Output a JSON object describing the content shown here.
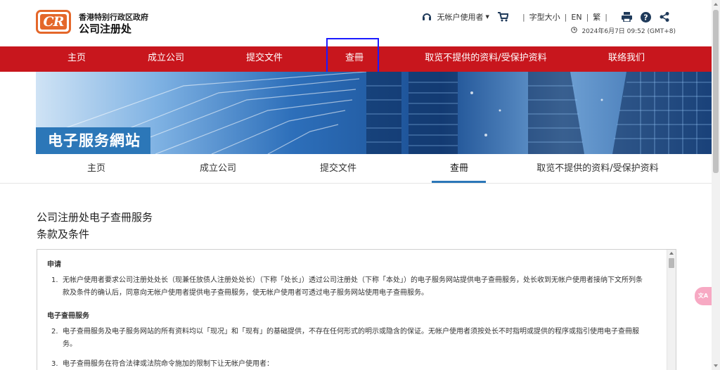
{
  "header": {
    "logo_badge": "CR",
    "org_line1": "香港特别行政区政府",
    "org_line2": "公司注册处",
    "user_label": "无帐户使用者",
    "font_size_label": "字型大小",
    "lang_en": "EN",
    "lang_tc": "繁",
    "datetime": "2024年6月7日 09:52 (GMT+8)"
  },
  "main_nav": {
    "items": [
      {
        "label": "主页"
      },
      {
        "label": "成立公司"
      },
      {
        "label": "提交文件"
      },
      {
        "label": "查冊"
      },
      {
        "label": "取览不提供的资料/受保护资料"
      },
      {
        "label": "联络我们"
      }
    ],
    "focused_index": 3
  },
  "banner": {
    "title": "电子服务網站"
  },
  "sub_nav": {
    "items": [
      {
        "label": "主页"
      },
      {
        "label": "成立公司"
      },
      {
        "label": "提交文件"
      },
      {
        "label": "查冊"
      },
      {
        "label": "取览不提供的资料/受保护资料"
      }
    ],
    "active_index": 3
  },
  "content": {
    "title": "公司注册处电子查冊服务",
    "subtitle": "条款及条件",
    "section1_heading": "申请",
    "clause1_num": "1.",
    "clause1_text": "无帐户使用者要求公司注册处处长（现兼任放债人注册处处长）（下称「处长」）透过公司注册处（下称「本处」）的电子服务网站提供电子查冊服务，处长收到无帐户使用者接纳下文所列条款及条件的确认后，同意向无帐户使用者提供电子查冊服务，使无帐户使用者可透过电子服务网站使用电子查冊服务。",
    "section2_heading": "电子查冊服务",
    "clause2_num": "2.",
    "clause2_text": "电子查冊服务及电子服务网站的所有资料均以「现况」和「现有」的基础提供，不存在任何形式的明示或隐含的保证。无帐户使用者须按处长不时指明或提供的程序或指引使用电子查冊服务。",
    "clause3_num": "3.",
    "clause3_text": "电子查冊服务在符合法律或法院命令施加的限制下让无帐户使用者："
  },
  "float_button": {
    "label": "文A"
  },
  "colors": {
    "brand_red": "#c8161d",
    "logo_orange": "#e4672a",
    "accent_blue": "#2c77b8",
    "focus_outline": "#1b1bff"
  }
}
